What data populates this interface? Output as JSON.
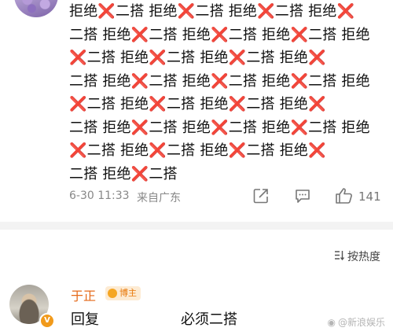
{
  "comment": {
    "segments": [
      "拒绝",
      "❌",
      "二搭 ",
      "拒绝",
      "❌",
      "二搭 ",
      "拒绝",
      "❌",
      "二搭 ",
      "拒绝",
      "❌",
      "二搭 ",
      "拒绝",
      "❌",
      "二搭 ",
      "拒绝",
      "❌",
      "二搭 ",
      "拒绝",
      "❌",
      "二搭 ",
      "拒绝",
      "❌",
      "二搭 ",
      "拒绝",
      "❌",
      "二搭 ",
      "拒绝",
      "❌",
      "二搭 ",
      "拒绝",
      "❌",
      "二搭 ",
      "拒绝",
      "❌",
      "二搭 ",
      "拒绝",
      "❌",
      "二搭 ",
      "拒绝",
      "❌",
      "二搭 ",
      "拒绝",
      "❌",
      "二搭 ",
      "拒绝",
      "❌",
      "二搭 ",
      "拒绝",
      "❌",
      "二搭 ",
      "拒绝",
      "❌",
      "二搭 ",
      "拒绝",
      "❌",
      "二搭 ",
      "拒绝",
      "❌",
      "二搭 ",
      "拒绝",
      "❌",
      "二搭 ",
      "拒绝",
      "❌",
      "二搭 ",
      "拒绝",
      "❌",
      "二搭 ",
      "拒绝",
      "❌",
      "二搭 ",
      "拒绝",
      "❌",
      "二搭 ",
      "拒绝",
      "❌",
      "二搭"
    ],
    "time": "6-30 11:33",
    "source": "来自广东",
    "like_count": "141",
    "icons": {
      "share": "share-icon",
      "comment": "comment-icon",
      "like": "thumbs-up-icon"
    }
  },
  "sort": {
    "label": "按热度",
    "icon": "sort-icon"
  },
  "reply": {
    "author": "于正",
    "tag": "博主",
    "prefix": "回复",
    "mention": "",
    "text": "必须二搭",
    "badge": "V"
  },
  "watermark": {
    "text": "@新浪娱乐"
  },
  "colors": {
    "x_mark": "#e0262e",
    "author": "#e56a1a",
    "tag_bg": "#fdebd3",
    "badge": "#f19a1b"
  }
}
